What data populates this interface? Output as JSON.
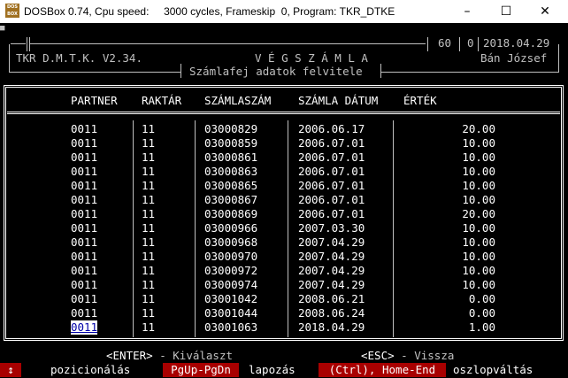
{
  "window": {
    "title": "DOSBox 0.74, Cpu speed:     3000 cycles, Frameskip  0, Program: TKR_DTKE",
    "icon_label": "DOS BOX",
    "minimize_glyph": "–",
    "maximize_glyph": "☐",
    "close_glyph": "✕"
  },
  "console": {
    "corner_marker": "■",
    "header": {
      "app_name": "TKR D.M.T.K. V2.34.",
      "doc_title": "V É G S Z Á M L A",
      "subtitle": "Számlafej adatok felvitele",
      "counter1": "60",
      "counter2": "0",
      "date": "2018.04.29",
      "user": "Bán József"
    },
    "columns": [
      "PARTNER",
      "RAKTÁR",
      "SZÁMLASZÁM",
      "SZÁMLA DÁTUM",
      "ÉRTÉK"
    ],
    "rows": [
      {
        "partner": "0011",
        "raktar": "11",
        "szamlaszam": "03000829",
        "datum": "2006.06.17",
        "ertek": "20.00"
      },
      {
        "partner": "0011",
        "raktar": "11",
        "szamlaszam": "03000859",
        "datum": "2006.07.01",
        "ertek": "10.00"
      },
      {
        "partner": "0011",
        "raktar": "11",
        "szamlaszam": "03000861",
        "datum": "2006.07.01",
        "ertek": "10.00"
      },
      {
        "partner": "0011",
        "raktar": "11",
        "szamlaszam": "03000863",
        "datum": "2006.07.01",
        "ertek": "10.00"
      },
      {
        "partner": "0011",
        "raktar": "11",
        "szamlaszam": "03000865",
        "datum": "2006.07.01",
        "ertek": "10.00"
      },
      {
        "partner": "0011",
        "raktar": "11",
        "szamlaszam": "03000867",
        "datum": "2006.07.01",
        "ertek": "10.00"
      },
      {
        "partner": "0011",
        "raktar": "11",
        "szamlaszam": "03000869",
        "datum": "2006.07.01",
        "ertek": "20.00"
      },
      {
        "partner": "0011",
        "raktar": "11",
        "szamlaszam": "03000966",
        "datum": "2007.03.30",
        "ertek": "10.00"
      },
      {
        "partner": "0011",
        "raktar": "11",
        "szamlaszam": "03000968",
        "datum": "2007.04.29",
        "ertek": "10.00"
      },
      {
        "partner": "0011",
        "raktar": "11",
        "szamlaszam": "03000970",
        "datum": "2007.04.29",
        "ertek": "10.00"
      },
      {
        "partner": "0011",
        "raktar": "11",
        "szamlaszam": "03000972",
        "datum": "2007.04.29",
        "ertek": "10.00"
      },
      {
        "partner": "0011",
        "raktar": "11",
        "szamlaszam": "03000974",
        "datum": "2007.04.29",
        "ertek": "10.00"
      },
      {
        "partner": "0011",
        "raktar": "11",
        "szamlaszam": "03001042",
        "datum": "2008.06.21",
        "ertek": "0.00"
      },
      {
        "partner": "0011",
        "raktar": "11",
        "szamlaszam": "03001044",
        "datum": "2008.06.24",
        "ertek": "0.00"
      },
      {
        "partner": "0011",
        "raktar": "11",
        "szamlaszam": "03001063",
        "datum": "2018.04.29",
        "ertek": "1.00"
      }
    ],
    "selected_row": 14,
    "hints": {
      "enter_key": "<ENTER>",
      "enter_text": " - Kiválaszt",
      "esc_key": "<ESC>",
      "esc_text": " - Vissza"
    },
    "keybar": {
      "arrow": "↕",
      "positioning": "pozicionálás",
      "pgupdn": "PgUp-PgDn",
      "paging": "lapozás",
      "homeend": "(Ctrl), Home-End",
      "colswitch": "oszlopváltás"
    }
  }
}
